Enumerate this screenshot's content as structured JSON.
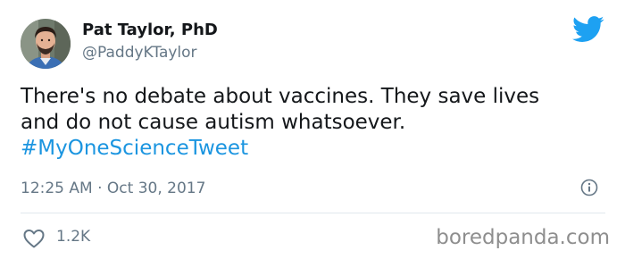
{
  "tweet": {
    "author": {
      "display_name": "Pat Taylor, PhD",
      "handle": "@PaddyKTaylor"
    },
    "text_line1": "There's no debate about vaccines. They save lives",
    "text_line2": "and do not cause autism whatsoever.",
    "hashtag": "#MyOneScienceTweet",
    "timestamp": "12:25 AM · Oct 30, 2017",
    "like_count": "1.2K"
  },
  "watermark": "boredpanda.com",
  "icons": {
    "brand": "twitter-bird-icon",
    "info": "info-icon",
    "like": "heart-icon"
  },
  "colors": {
    "twitter_blue": "#1da1f2",
    "hashtag_blue": "#1b95e0",
    "text": "#14171a",
    "secondary_text": "#657786",
    "divider": "#e1e8ed"
  }
}
